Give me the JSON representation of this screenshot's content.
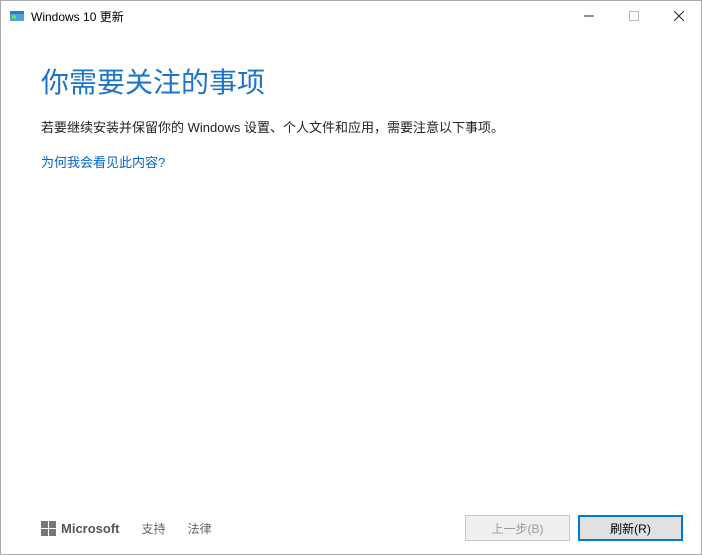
{
  "window": {
    "title": "Windows 10 更新"
  },
  "main": {
    "heading": "你需要关注的事项",
    "subtext": "若要继续安装并保留你的 Windows 设置、个人文件和应用，需要注意以下事项。",
    "help_link": "为何我会看见此内容?"
  },
  "footer": {
    "brand": "Microsoft",
    "support_link": "支持",
    "legal_link": "法律",
    "back_button": "上一步(B)",
    "refresh_button": "刷新(R)"
  }
}
